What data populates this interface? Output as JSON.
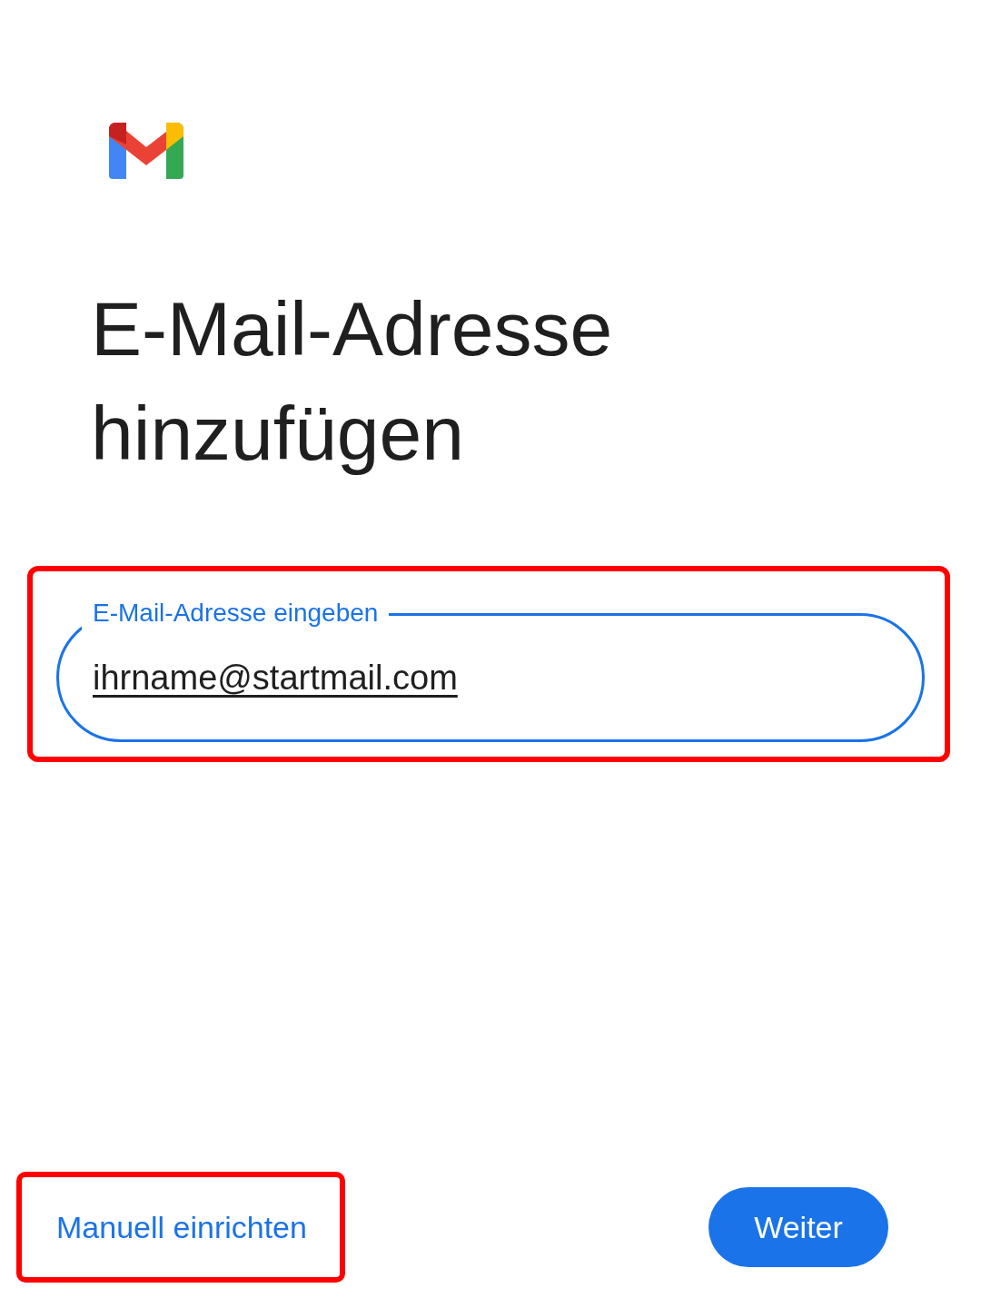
{
  "title": "E-Mail-Adresse hinzufügen",
  "email_field": {
    "label": "E-Mail-Adresse eingeben",
    "value": "ihrname@startmail.com",
    "focused": true,
    "highlighted": true
  },
  "buttons": [
    {
      "kind": "text",
      "label": "Manuell einrichten",
      "highlighted": true
    },
    {
      "kind": "filled",
      "label": "Weiter",
      "highlighted": false
    }
  ]
}
